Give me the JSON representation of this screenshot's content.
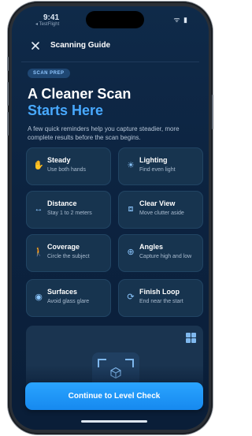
{
  "status": {
    "time": "9:41",
    "sub": "◂ TestFlight",
    "icons": "ᯤ ▮"
  },
  "header": {
    "title": "Scanning Guide"
  },
  "badge": "SCAN PREP",
  "headline": {
    "line1": "A Cleaner Scan",
    "line2": "Starts Here"
  },
  "intro": "A few quick reminders help you capture steadier, more complete results before the scan begins.",
  "tips": [
    {
      "title": "Steady",
      "subtitle": "Use both hands",
      "icon": "hand-icon"
    },
    {
      "title": "Lighting",
      "subtitle": "Find even light",
      "icon": "sun-icon"
    },
    {
      "title": "Distance",
      "subtitle": "Stay 1 to 2 meters",
      "icon": "arrows-horizontal-icon"
    },
    {
      "title": "Clear View",
      "subtitle": "Move clutter aside",
      "icon": "clear-view-icon"
    },
    {
      "title": "Coverage",
      "subtitle": "Circle the subject",
      "icon": "walk-icon"
    },
    {
      "title": "Angles",
      "subtitle": "Capture high and low",
      "icon": "globe-icon"
    },
    {
      "title": "Surfaces",
      "subtitle": "Avoid glass glare",
      "icon": "eye-icon"
    },
    {
      "title": "Finish Loop",
      "subtitle": "End near the start",
      "icon": "loop-arrows-icon"
    }
  ],
  "cta": {
    "label": "Continue to Level Check"
  },
  "colors": {
    "accent": "#48a9ff",
    "button": "#1f97fb",
    "background": "#0c2340"
  }
}
